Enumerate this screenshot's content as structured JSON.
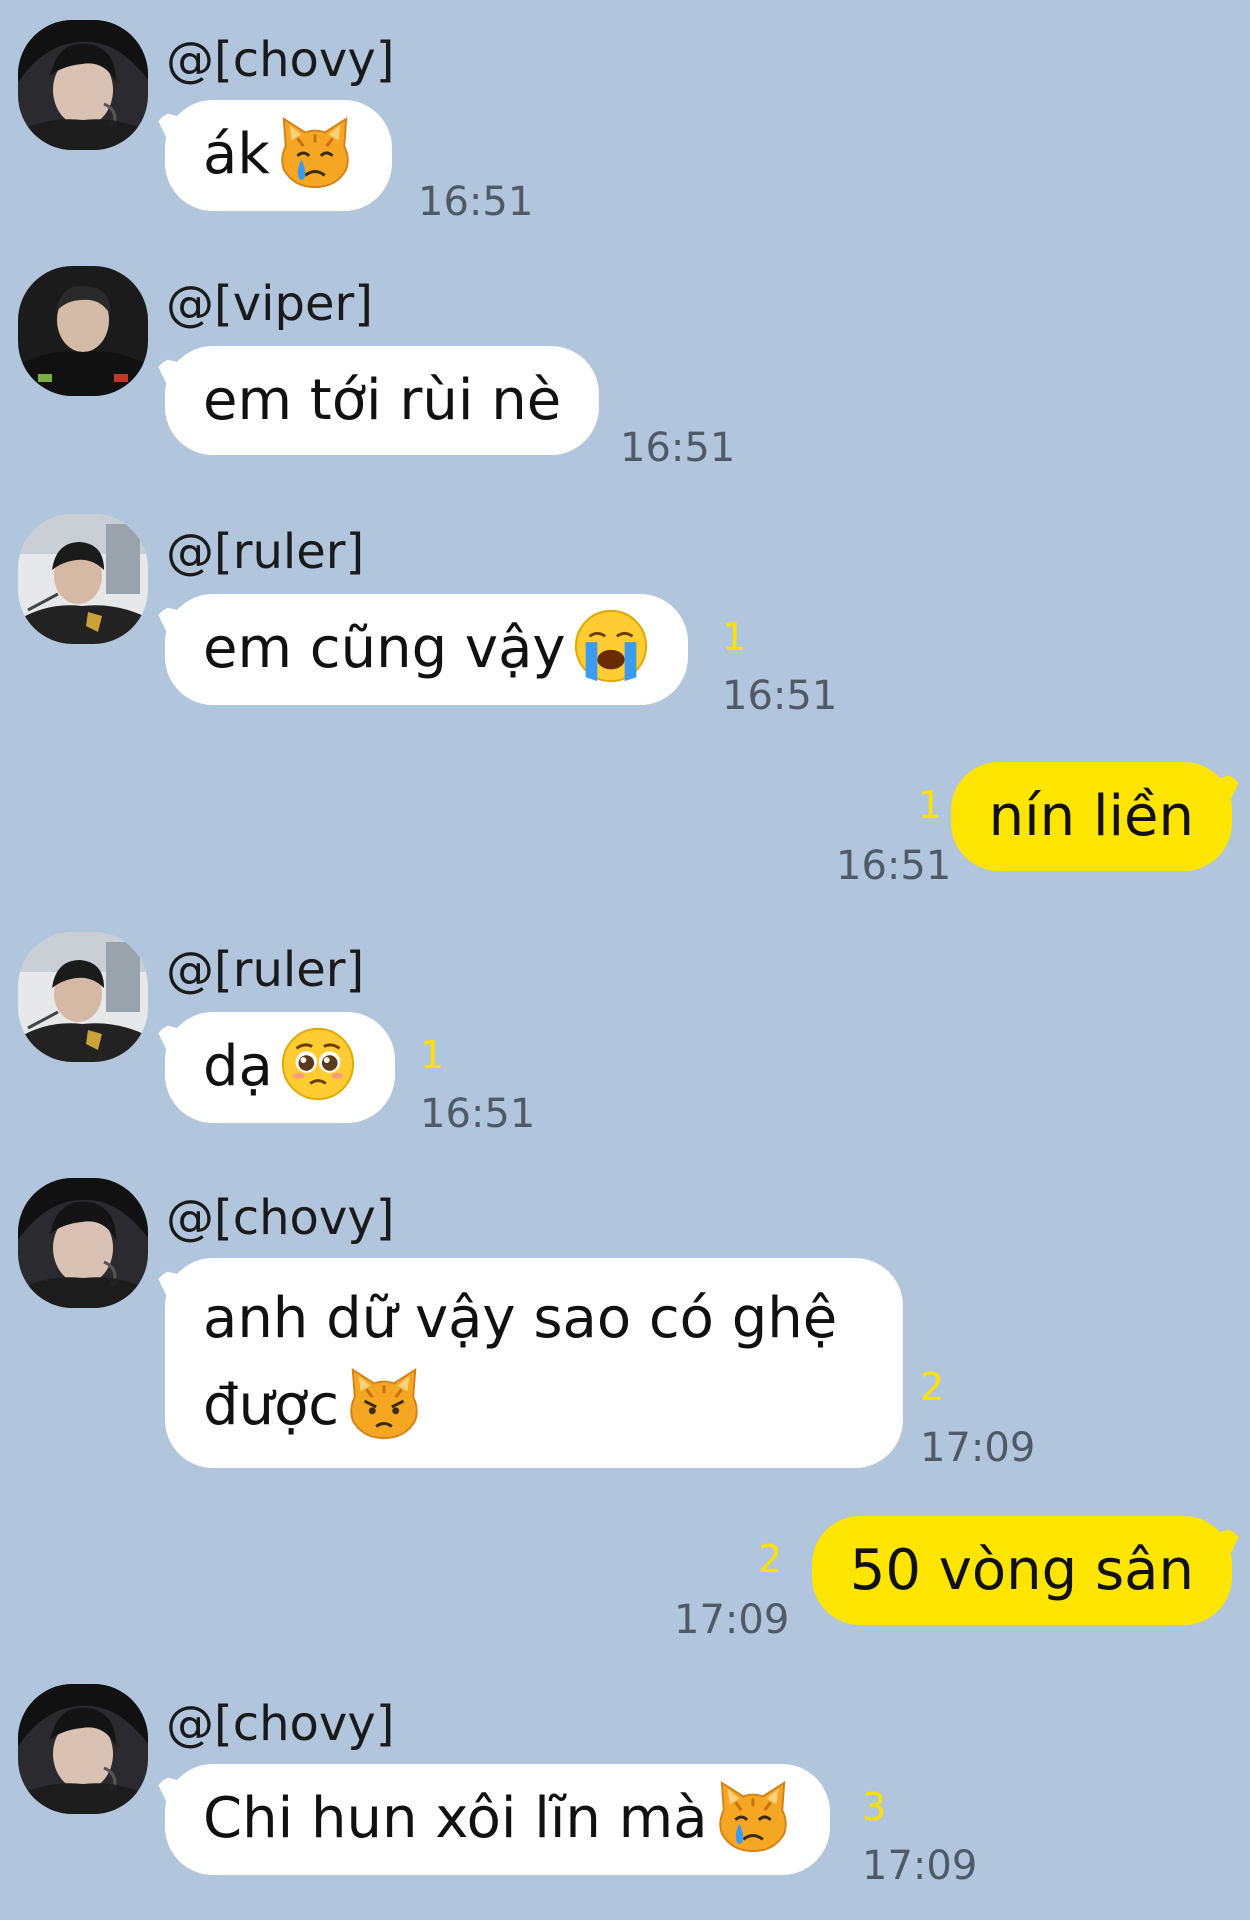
{
  "messages": [
    {
      "sender": "@[chovy]",
      "text": "ák",
      "emoji": "crying-cat-icon",
      "time": "16:51",
      "unread": ""
    },
    {
      "sender": "@[viper]",
      "text": "em tới rùi nè",
      "time": "16:51",
      "unread": ""
    },
    {
      "sender": "@[ruler]",
      "text": "em cũng vậy",
      "emoji": "loudly-crying-face-icon",
      "time": "16:51",
      "unread": "1"
    },
    {
      "text": "nín liền",
      "time": "16:51",
      "unread": "1"
    },
    {
      "sender": "@[ruler]",
      "text": "dạ",
      "emoji": "pleading-face-icon",
      "time": "16:51",
      "unread": "1"
    },
    {
      "sender": "@[chovy]",
      "line1": "anh dữ vậy sao có ghệ",
      "line2": "được",
      "emoji": "pouting-cat-icon",
      "time": "17:09",
      "unread": "2"
    },
    {
      "text": "50 vòng sân",
      "time": "17:09",
      "unread": "2"
    },
    {
      "sender": "@[chovy]",
      "text": "Chi hun xôi lĩn mà",
      "emoji": "crying-cat-icon",
      "time": "17:09",
      "unread": "3"
    }
  ],
  "colors": {
    "background": "#b1c6dc",
    "incoming_bubble": "#ffffff",
    "outgoing_bubble": "#fee500",
    "unread_count": "#ffe100",
    "timestamp": "#4f5a66"
  }
}
